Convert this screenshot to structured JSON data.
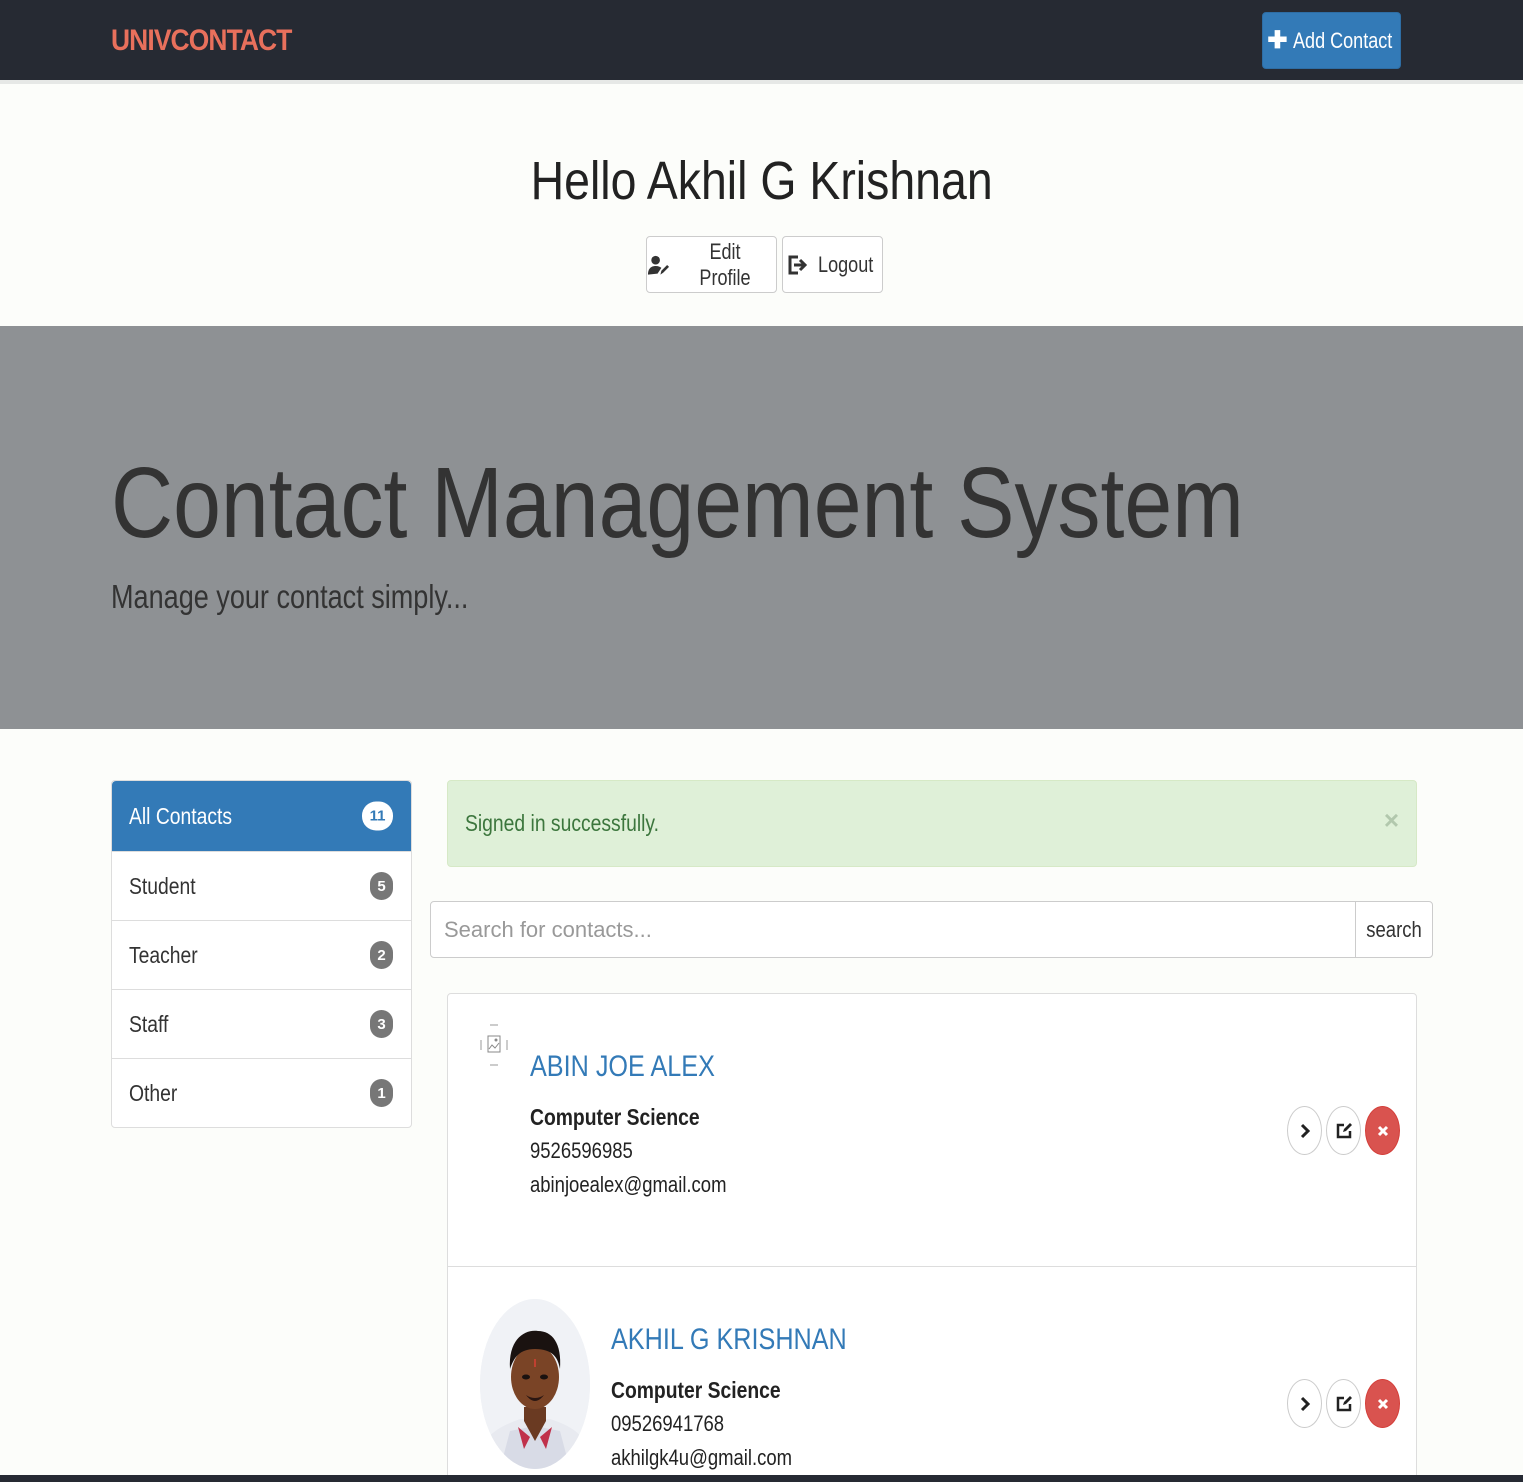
{
  "navbar": {
    "brand": "UNIVCONTACT",
    "add_contact_label": "Add Contact",
    "add_contact_icon": "plus-icon"
  },
  "greeting": {
    "text": "Hello Akhil G Krishnan",
    "edit_profile_label": "Edit Profile",
    "edit_profile_icon": "user-edit-icon",
    "logout_label": "Logout",
    "logout_icon": "sign-out-icon"
  },
  "jumbotron": {
    "title": "Contact Management System",
    "subtitle": "Manage your contact simply..."
  },
  "categories": [
    {
      "label": "All Contacts",
      "count": "11",
      "active": true
    },
    {
      "label": "Student",
      "count": "5"
    },
    {
      "label": "Teacher",
      "count": "2"
    },
    {
      "label": "Staff",
      "count": "3"
    },
    {
      "label": "Other",
      "count": "1"
    }
  ],
  "alert": {
    "message": "Signed in successfully.",
    "close": "×"
  },
  "search": {
    "placeholder": "Search for contacts...",
    "button_label": "search"
  },
  "contacts": [
    {
      "name": "ABIN JOE ALEX",
      "department": "Computer Science",
      "phone": "9526596985",
      "email": "abinjoealex@gmail.com",
      "photo": "broken-image-icon"
    },
    {
      "name": "AKHIL G KRISHNAN",
      "department": "Computer Science",
      "phone": "09526941768",
      "email": "akhilgk4u@gmail.com",
      "photo": "profile-photo"
    }
  ],
  "colors": {
    "navbar_bg": "#262a33",
    "brand": "#e8705c",
    "primary": "#337ab7",
    "jumbotron_bg": "#8e9194",
    "alert_bg": "#dff0d8",
    "alert_text": "#3c763d",
    "danger": "#d9534f"
  }
}
